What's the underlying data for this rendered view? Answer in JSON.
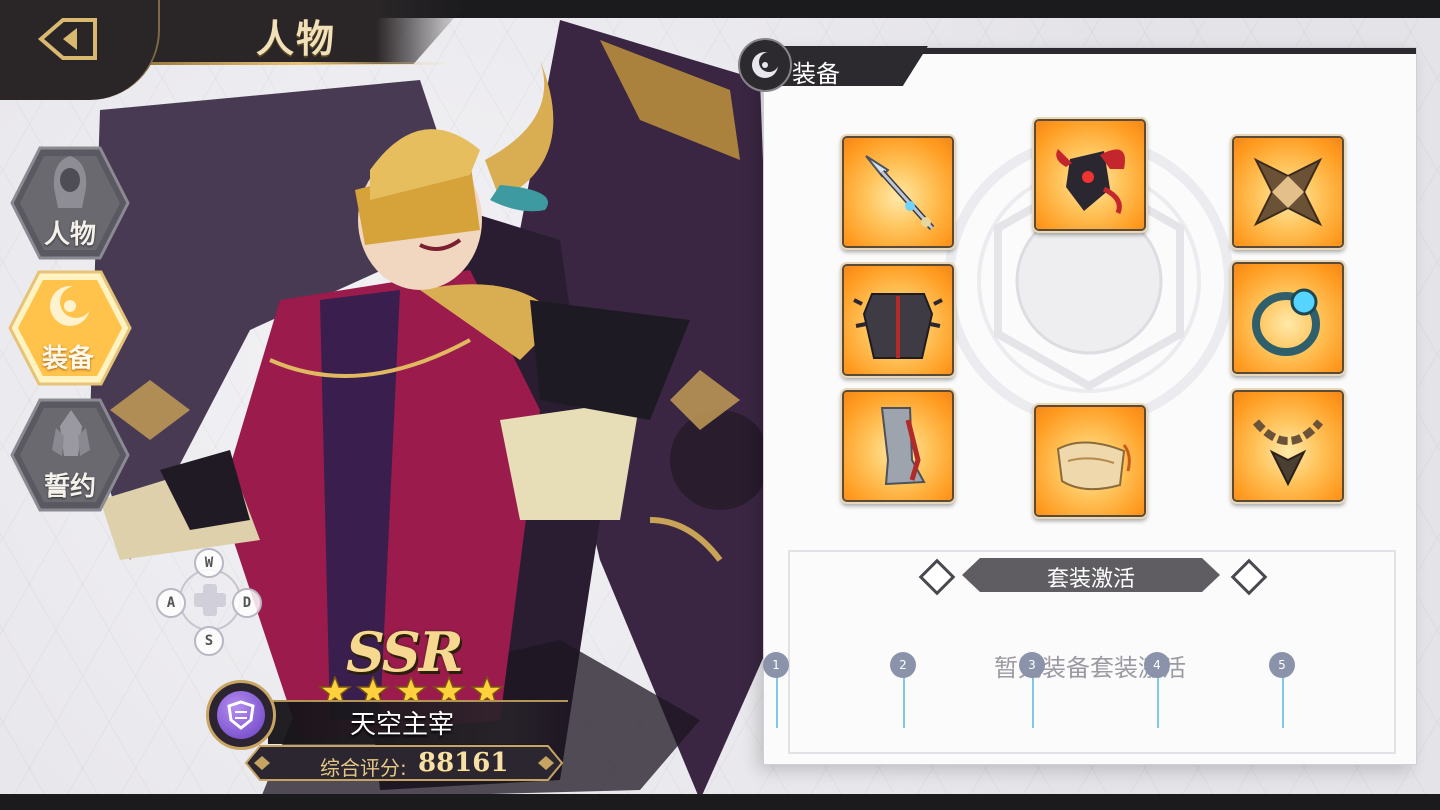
{
  "header": {
    "title": "人物",
    "back_icon": "back-arrow-icon"
  },
  "sidenav": {
    "items": [
      {
        "label": "人物",
        "icon": "hooded-figure-icon",
        "active": false
      },
      {
        "label": "装备",
        "icon": "moon-sun-icon",
        "active": true
      },
      {
        "label": "誓约",
        "icon": "crystal-icon",
        "active": false
      }
    ]
  },
  "controls": {
    "keys": [
      "W",
      "A",
      "S",
      "D"
    ]
  },
  "character": {
    "rarity": "SSR",
    "stars": 5,
    "name": "天空主宰",
    "score_label": "综合评分:",
    "score_value": "88161",
    "class_icon": "shield-icon"
  },
  "equipment": {
    "title": "装备",
    "slots": [
      {
        "name": "spear",
        "icon": "spear-icon"
      },
      {
        "name": "helmet",
        "icon": "horned-helmet-icon"
      },
      {
        "name": "shoulder",
        "icon": "shoulder-guard-icon"
      },
      {
        "name": "armor",
        "icon": "spiked-armor-icon"
      },
      {
        "name": "ring",
        "icon": "ring-icon"
      },
      {
        "name": "boots",
        "icon": "greaves-icon"
      },
      {
        "name": "cloak",
        "icon": "cloth-icon"
      },
      {
        "name": "necklace",
        "icon": "chain-necklace-icon"
      }
    ]
  },
  "set_bonus": {
    "title": "套装激活",
    "empty_text": "暂无装备套装激活",
    "markers": [
      "1",
      "2",
      "3",
      "4",
      "5"
    ]
  },
  "colors": {
    "accent_gold": "#e7c377",
    "slot_orange": "#ff9a1f",
    "dark_plate": "#2c2a2e"
  }
}
